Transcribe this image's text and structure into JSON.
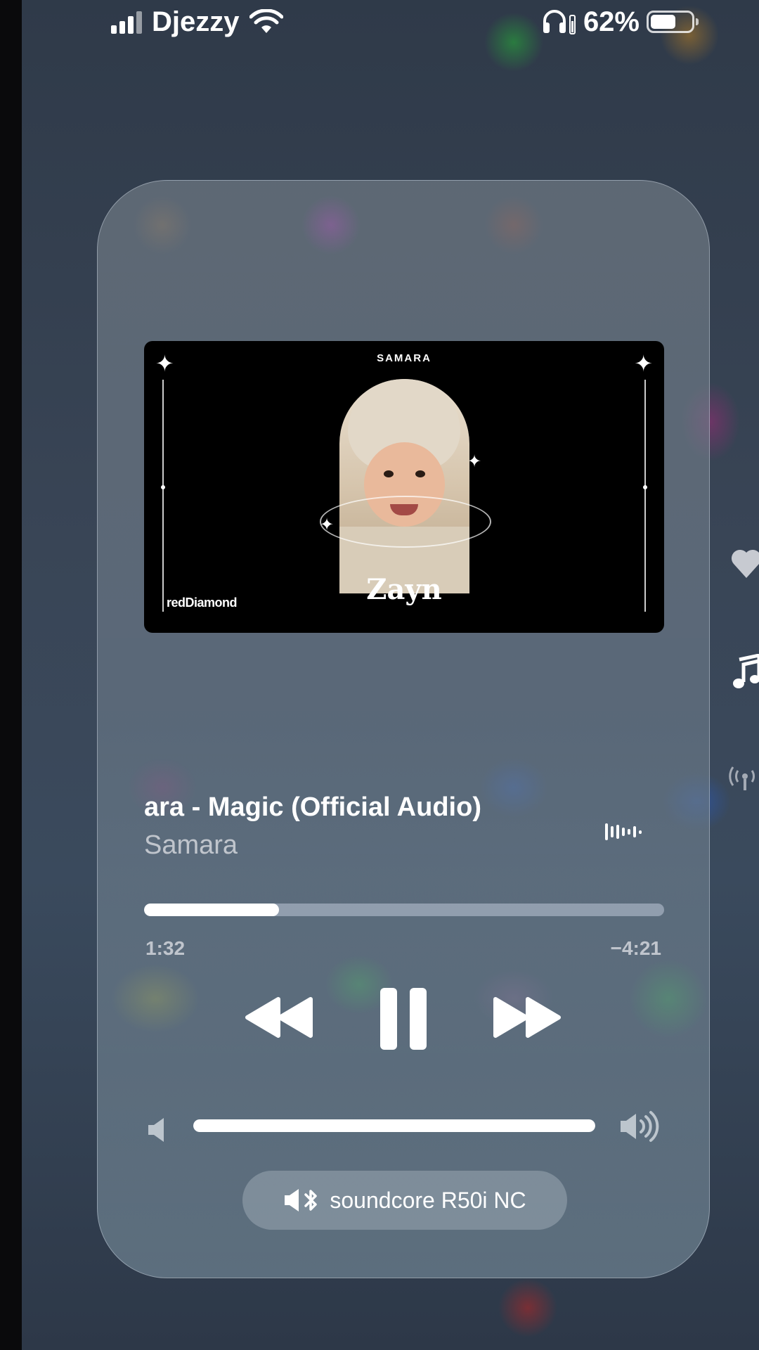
{
  "status_bar": {
    "carrier": "Djezzy",
    "battery_percent": "62%",
    "battery_level": 0.62,
    "signal_bars": 4,
    "icons": [
      "signal-icon",
      "wifi-icon",
      "headphones-icon",
      "battery-icon"
    ]
  },
  "now_playing": {
    "artwork": {
      "top_label": "SAMARA",
      "watermark": "redDiamond",
      "name_text": "Zayn"
    },
    "title": "ara - Magic (Official Audio)",
    "artist": "Samara",
    "elapsed": "1:32",
    "remaining": "−4:21",
    "progress_fraction": 0.26,
    "volume_fraction": 1.0,
    "controls": [
      "rewind-icon",
      "pause-icon",
      "fast-forward-icon"
    ],
    "output_device": "soundcore R50i NC"
  },
  "side_icons": [
    "heart-icon",
    "music-note-icon",
    "broadcast-icon"
  ]
}
